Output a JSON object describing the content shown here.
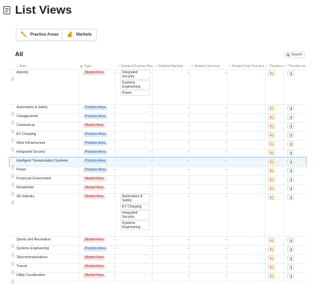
{
  "page": {
    "title": "List Views",
    "section_title": "All",
    "search_label": "Search"
  },
  "view_buttons": [
    {
      "label": "Practice Areas",
      "icon": "pencil-icon",
      "emoji": "✏️"
    },
    {
      "label": "Markets",
      "icon": "money-bag-icon",
      "emoji": "💰"
    }
  ],
  "columns": [
    {
      "label": "Item",
      "icon": "text-icon"
    },
    {
      "label": "Type",
      "icon": "select-icon"
    },
    {
      "label": "Related Practice Areas",
      "icon": "relation-icon"
    },
    {
      "label": "Related Markets",
      "icon": "relation-icon"
    },
    {
      "label": "Related Services",
      "icon": "relation-icon"
    },
    {
      "label": "Related Sub Practices",
      "icon": "relation-icon"
    },
    {
      "label": "Thumbs up",
      "icon": "button-icon"
    },
    {
      "label": "Thumbs down",
      "icon": "button-icon"
    }
  ],
  "empty_value": "–",
  "colors": {
    "market_tag_bg": "#fbe1e1",
    "practice_tag_bg": "#dde9f7",
    "selection": "#9ccbea"
  },
  "rows": [
    {
      "item": "Airports",
      "type": "Market Area",
      "type_kind": "market",
      "related_practice_areas": [
        "Integrated Security",
        "Systems Engineering",
        "Power"
      ]
    },
    {
      "item": "Automation & Safety",
      "type": "Practice Area",
      "type_kind": "practice",
      "related_practice_areas": []
    },
    {
      "item": "Campgrounds",
      "type": "Practice Area",
      "type_kind": "practice",
      "related_practice_areas": []
    },
    {
      "item": "Commerical",
      "type": "Market Area",
      "type_kind": "market",
      "related_practice_areas": []
    },
    {
      "item": "EV Charging",
      "type": "Practice Area",
      "type_kind": "practice",
      "related_practice_areas": []
    },
    {
      "item": "Fibre Infrastructure",
      "type": "Practice Area",
      "type_kind": "practice",
      "related_practice_areas": []
    },
    {
      "item": "Integrated Security",
      "type": "Practice Area",
      "type_kind": "practice",
      "related_practice_areas": []
    },
    {
      "item": "Intelligent Transportation Systems",
      "type": "Practice Area",
      "type_kind": "practice",
      "related_practice_areas": [],
      "selected": true
    },
    {
      "item": "Power",
      "type": "Practice Area",
      "type_kind": "practice",
      "related_practice_areas": []
    },
    {
      "item": "Provincial Government",
      "type": "Market Area",
      "type_kind": "market",
      "related_practice_areas": []
    },
    {
      "item": "Residential",
      "type": "Market Area",
      "type_kind": "market",
      "related_practice_areas": []
    },
    {
      "item": "Ski Industry",
      "type": "Market Area",
      "type_kind": "market",
      "related_practice_areas": [
        "Automation & Safety",
        "EV Charging",
        "Integrated Security",
        "Systems Engineering"
      ]
    },
    {
      "item": "Sports and Recreation",
      "type": "Market Area",
      "type_kind": "market",
      "related_practice_areas": []
    },
    {
      "item": "Systems Engineering",
      "type": "Practice Area",
      "type_kind": "practice",
      "related_practice_areas": []
    },
    {
      "item": "Telecommunications",
      "type": "Market Area",
      "type_kind": "market",
      "related_practice_areas": []
    },
    {
      "item": "Transit",
      "type": "Market Area",
      "type_kind": "market",
      "related_practice_areas": []
    },
    {
      "item": "Utility Coordination",
      "type": "Market Area",
      "type_kind": "market",
      "related_practice_areas": []
    }
  ]
}
